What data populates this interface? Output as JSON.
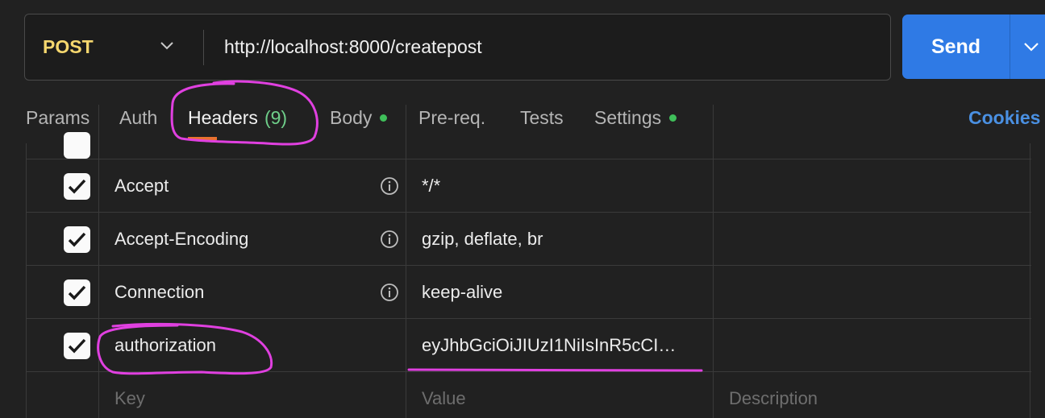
{
  "request": {
    "method": "POST",
    "url": "http://localhost:8000/createpost",
    "send_label": "Send"
  },
  "tabs": [
    {
      "label": "Params"
    },
    {
      "label": "Auth"
    },
    {
      "label": "Headers",
      "count": "(9)"
    },
    {
      "label": "Body"
    },
    {
      "label": "Pre-req."
    },
    {
      "label": "Tests"
    },
    {
      "label": "Settings"
    }
  ],
  "cookies_label": "Cookies",
  "headers": [
    {
      "key": "Accept",
      "value": "*/*"
    },
    {
      "key": "Accept-Encoding",
      "value": "gzip, deflate, br"
    },
    {
      "key": "Connection",
      "value": "keep-alive"
    },
    {
      "key": "authorization",
      "value": "eyJhbGciOiJIUzI1NiIsInR5cCI…"
    }
  ],
  "placeholders": {
    "key": "Key",
    "value": "Value",
    "description": "Description"
  },
  "colors": {
    "method": "#f5d76e",
    "send_button": "#2f7ae5",
    "cookies_link": "#4a90e2",
    "indicator_dot": "#3fbf5a",
    "annotation": "#e040e0"
  }
}
